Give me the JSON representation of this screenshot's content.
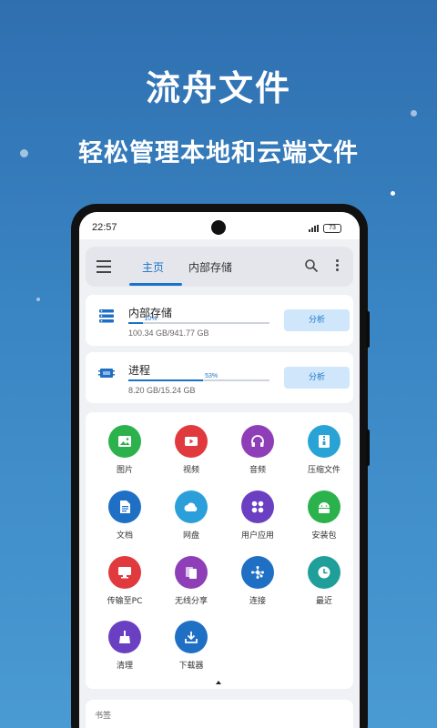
{
  "hero": {
    "title": "流舟文件",
    "subtitle": "轻松管理本地和云端文件"
  },
  "status_bar": {
    "time": "22:57",
    "battery": "73"
  },
  "toolbar": {
    "tabs": [
      "主页",
      "内部存储"
    ]
  },
  "storage_cards": [
    {
      "title": "内部存储",
      "percent_label": "10%",
      "fill": 0.1,
      "size": "100.34 GB/941.77 GB",
      "button": "分析"
    },
    {
      "title": "进程",
      "percent_label": "53%",
      "fill": 0.53,
      "size": "8.20 GB/15.24 GB",
      "button": "分析"
    }
  ],
  "categories": [
    {
      "label": "图片",
      "icon": "image-icon",
      "color": "#2bb24c"
    },
    {
      "label": "视频",
      "icon": "video-icon",
      "color": "#e0393e"
    },
    {
      "label": "音频",
      "icon": "headphones-icon",
      "color": "#8e3fb8"
    },
    {
      "label": "压缩文件",
      "icon": "archive-icon",
      "color": "#29a3d6"
    },
    {
      "label": "文档",
      "icon": "document-icon",
      "color": "#1f6fc5"
    },
    {
      "label": "网盘",
      "icon": "cloud-icon",
      "color": "#2a9fd9"
    },
    {
      "label": "用户应用",
      "icon": "apps-icon",
      "color": "#6a3fc2"
    },
    {
      "label": "安装包",
      "icon": "android-icon",
      "color": "#2bb24c"
    },
    {
      "label": "传输至PC",
      "icon": "monitor-icon",
      "color": "#e0393e"
    },
    {
      "label": "无线分享",
      "icon": "share-icon",
      "color": "#8e3fb8"
    },
    {
      "label": "连接",
      "icon": "connect-icon",
      "color": "#1f6fc5"
    },
    {
      "label": "最近",
      "icon": "clock-icon",
      "color": "#1f9e9a"
    },
    {
      "label": "清理",
      "icon": "broom-icon",
      "color": "#6a3fc2"
    },
    {
      "label": "下载器",
      "icon": "download-icon",
      "color": "#1f6fc5"
    }
  ],
  "bookmarks": {
    "title": "书签"
  }
}
